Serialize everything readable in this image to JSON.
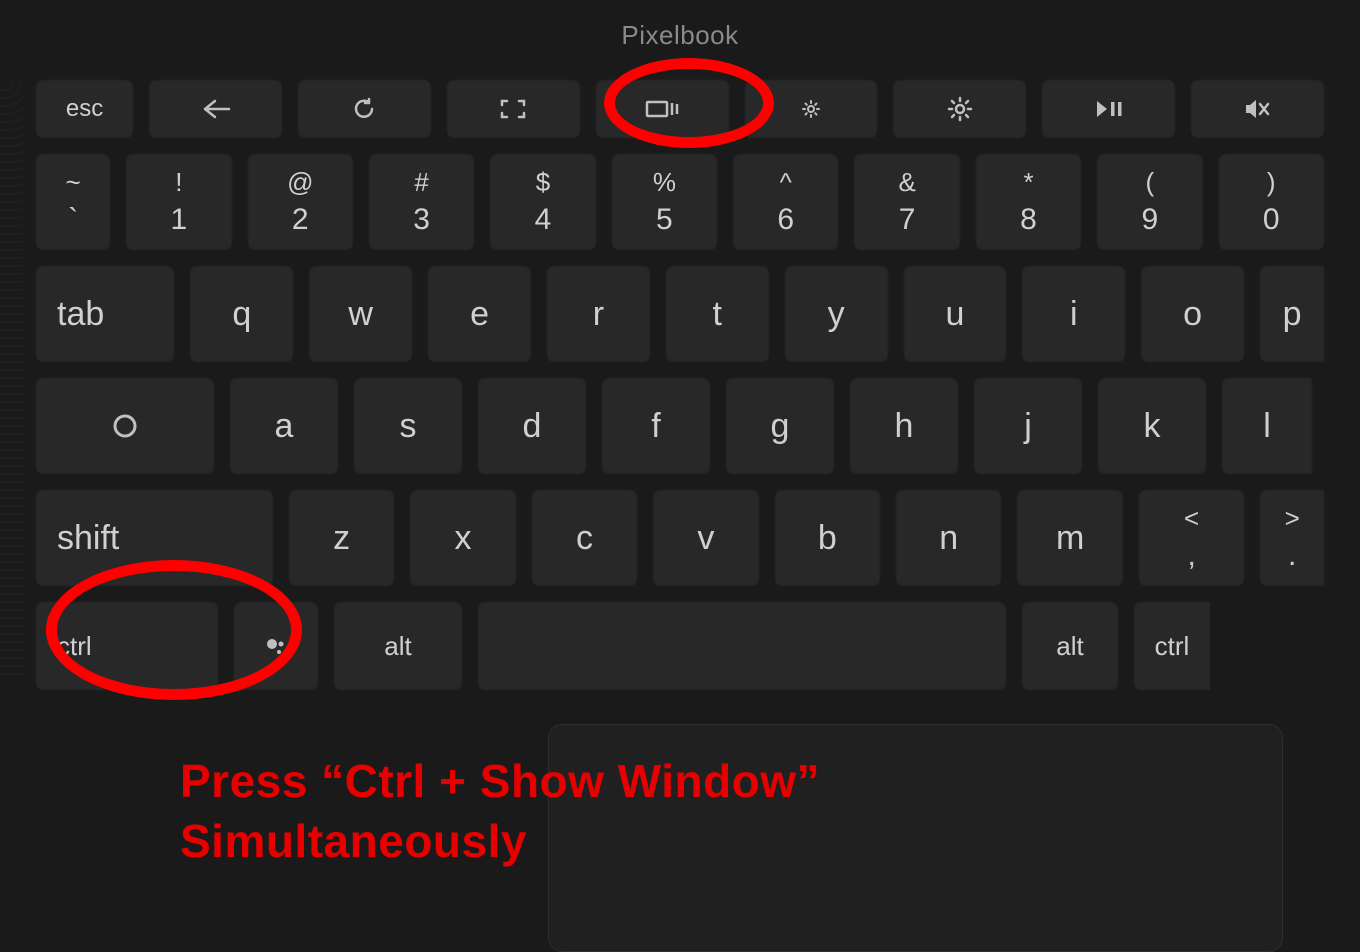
{
  "brand": "Pixelbook",
  "rows": {
    "function": [
      {
        "label": "esc",
        "name": "esc-key",
        "icon": null
      },
      {
        "label": "",
        "name": "back-key",
        "icon": "back-icon"
      },
      {
        "label": "",
        "name": "refresh-key",
        "icon": "refresh-icon"
      },
      {
        "label": "",
        "name": "fullscreen-key",
        "icon": "fullscreen-icon"
      },
      {
        "label": "",
        "name": "show-windows-key",
        "icon": "show-windows-icon"
      },
      {
        "label": "",
        "name": "brightness-down-key",
        "icon": "brightness-down-icon"
      },
      {
        "label": "",
        "name": "brightness-up-key",
        "icon": "brightness-up-icon"
      },
      {
        "label": "",
        "name": "play-pause-key",
        "icon": "play-pause-icon"
      },
      {
        "label": "",
        "name": "mute-key",
        "icon": "mute-icon"
      }
    ],
    "number": [
      {
        "top": "~",
        "bot": "`",
        "name": "backtick-key"
      },
      {
        "top": "!",
        "bot": "1",
        "name": "one-key"
      },
      {
        "top": "@",
        "bot": "2",
        "name": "two-key"
      },
      {
        "top": "#",
        "bot": "3",
        "name": "three-key"
      },
      {
        "top": "$",
        "bot": "4",
        "name": "four-key"
      },
      {
        "top": "%",
        "bot": "5",
        "name": "five-key"
      },
      {
        "top": "^",
        "bot": "6",
        "name": "six-key"
      },
      {
        "top": "&",
        "bot": "7",
        "name": "seven-key"
      },
      {
        "top": "*",
        "bot": "8",
        "name": "eight-key"
      },
      {
        "top": "(",
        "bot": "9",
        "name": "nine-key"
      },
      {
        "top": ")",
        "bot": "0",
        "name": "zero-key"
      }
    ],
    "qrow": {
      "mod": "tab",
      "letters": [
        "q",
        "w",
        "e",
        "r",
        "t",
        "y",
        "u",
        "i",
        "o",
        "p"
      ]
    },
    "arow": {
      "letters": [
        "a",
        "s",
        "d",
        "f",
        "g",
        "h",
        "j",
        "k",
        "l"
      ]
    },
    "zrow": {
      "mod": "shift",
      "letters": [
        "z",
        "x",
        "c",
        "v",
        "b",
        "n",
        "m"
      ],
      "punc": [
        {
          "top": "<",
          "bot": ",",
          "name": "comma-key"
        },
        {
          "top": ">",
          "bot": ".",
          "name": "period-key"
        }
      ]
    },
    "bottom": {
      "ctrl": "ctrl",
      "alt": "alt",
      "ralt": "alt",
      "rctrl": "ctrl"
    }
  },
  "annotation": {
    "line1": "Press “Ctrl + Show Window”",
    "line2": "Simultaneously"
  }
}
